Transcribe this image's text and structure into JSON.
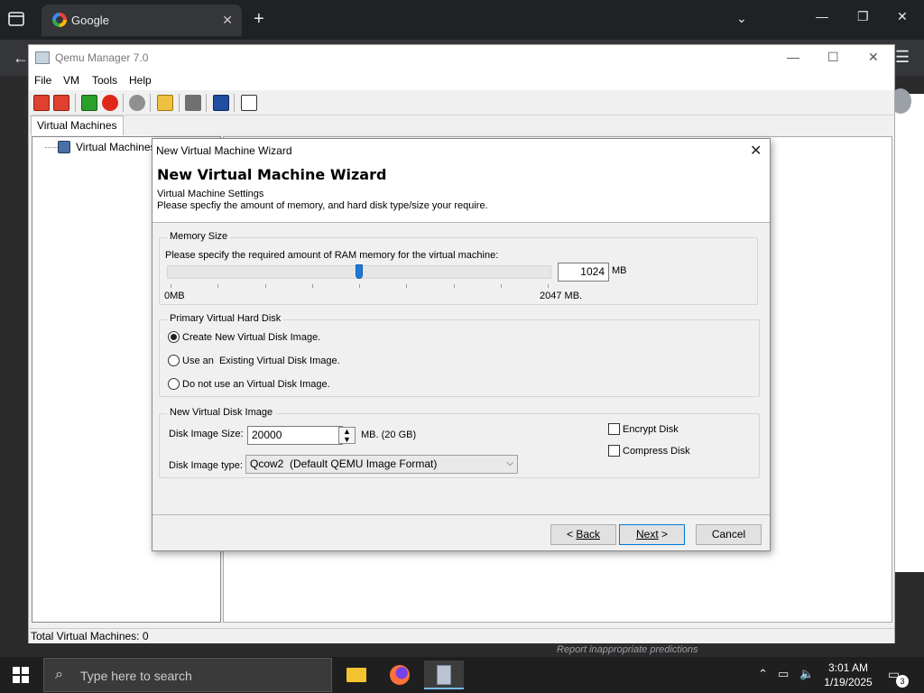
{
  "browser": {
    "tab_title": "Google",
    "report_text": "Report inappropriate predictions"
  },
  "app": {
    "title": "Qemu Manager 7.0",
    "menu": [
      "File",
      "VM",
      "Tools",
      "Help"
    ],
    "toolbar_icons": [
      "add-vm-icon",
      "remove-vm-icon",
      "start-vm-icon",
      "stop-vm-icon",
      "network-icon",
      "open-folder-icon",
      "tools-icon",
      "save-icon",
      "settings-icon"
    ],
    "tab_label": "Virtual Machines",
    "tree_root": "Virtual Machines",
    "status": "Total Virtual Machines: 0"
  },
  "wizard": {
    "window_title": "New Virtual Machine Wizard",
    "heading": "New Virtual Machine Wizard",
    "subtitle1": "Virtual Machine Settings",
    "subtitle2": "Please specfiy the amount of memory, and hard disk type/size your require.",
    "memory": {
      "group_title": "Memory Size",
      "prompt": "Please specify the required amount of RAM memory for the virtual machine:",
      "value": "1024",
      "unit": "MB",
      "min_label": "0MB",
      "max_label": "2047 MB.",
      "slider_fraction": 0.5
    },
    "primary_disk": {
      "group_title": "Primary Virtual Hard Disk",
      "options": [
        "Create New Virtual Disk Image.",
        "Use an  Existing Virtual Disk Image.",
        "Do not use an Virtual Disk Image."
      ],
      "selected_index": 0
    },
    "new_disk": {
      "group_title": "New Virtual Disk Image",
      "size_label": "Disk Image Size:",
      "size_value": "20000",
      "size_unit": "MB. (20 GB)",
      "type_label": "Disk Image type:",
      "type_value": "Qcow2  (Default QEMU Image Format)",
      "encrypt_label": "Encrypt Disk",
      "compress_label": "Compress Disk",
      "encrypt_checked": false,
      "compress_checked": false
    },
    "buttons": {
      "back": "Back",
      "next": "Next",
      "cancel": "Cancel"
    }
  },
  "taskbar": {
    "search_placeholder": "Type here to search",
    "time": "3:01 AM",
    "date": "1/19/2025",
    "notification_count": "3"
  }
}
